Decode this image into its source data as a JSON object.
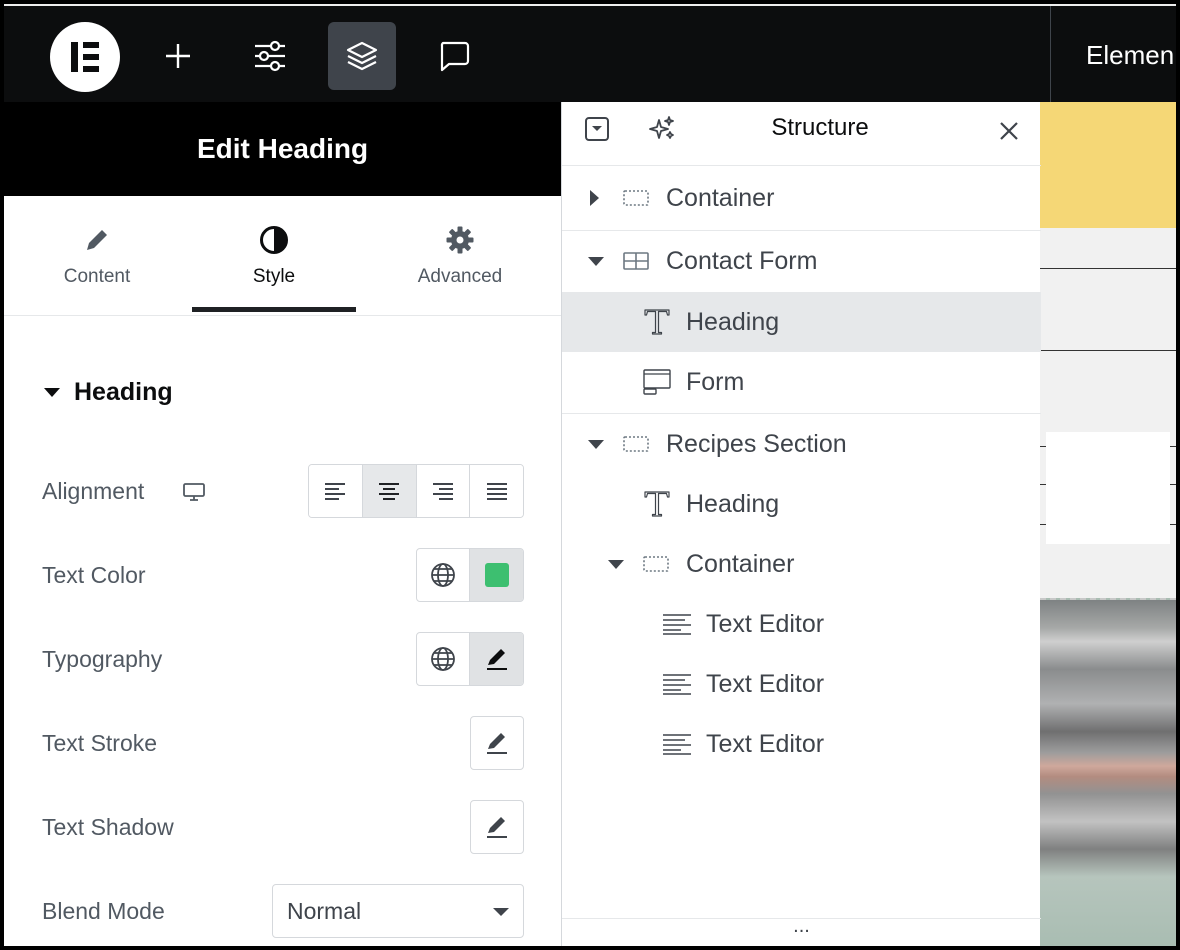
{
  "topbar": {
    "logo_alt": "Elementor",
    "title": "Elemen"
  },
  "panel": {
    "header_title": "Edit Heading",
    "tabs": [
      {
        "label": "Content",
        "icon": "pencil-icon"
      },
      {
        "label": "Style",
        "icon": "half-circle-icon",
        "active": true
      },
      {
        "label": "Advanced",
        "icon": "gear-icon"
      }
    ],
    "section_title": "Heading",
    "controls": {
      "alignment_label": "Alignment",
      "text_color_label": "Text Color",
      "text_color_value": "#3dbf70",
      "typography_label": "Typography",
      "text_stroke_label": "Text Stroke",
      "text_shadow_label": "Text Shadow",
      "blend_mode_label": "Blend Mode",
      "blend_mode_value": "Normal"
    }
  },
  "structure": {
    "title": "Structure",
    "items": [
      {
        "label": "Container",
        "icon": "container-icon",
        "caret": "collapsed"
      },
      {
        "label": "Contact Form",
        "icon": "grid-icon",
        "caret": "expanded"
      },
      {
        "label": "Heading",
        "icon": "heading-t-icon",
        "selected": true
      },
      {
        "label": "Form",
        "icon": "form-icon"
      },
      {
        "label": "Recipes Section",
        "icon": "container-icon",
        "caret": "expanded"
      },
      {
        "label": "Heading",
        "icon": "heading-t-icon"
      },
      {
        "label": "Container",
        "icon": "container-icon",
        "caret": "expanded"
      },
      {
        "label": "Text Editor",
        "icon": "text-editor-icon"
      },
      {
        "label": "Text Editor",
        "icon": "text-editor-icon"
      },
      {
        "label": "Text Editor",
        "icon": "text-editor-icon"
      }
    ],
    "footer": "..."
  },
  "colors": {
    "topbar_bg": "#0c0d0e",
    "accent_text_color": "#3dbf70",
    "canvas_yellow": "#f5d776"
  }
}
